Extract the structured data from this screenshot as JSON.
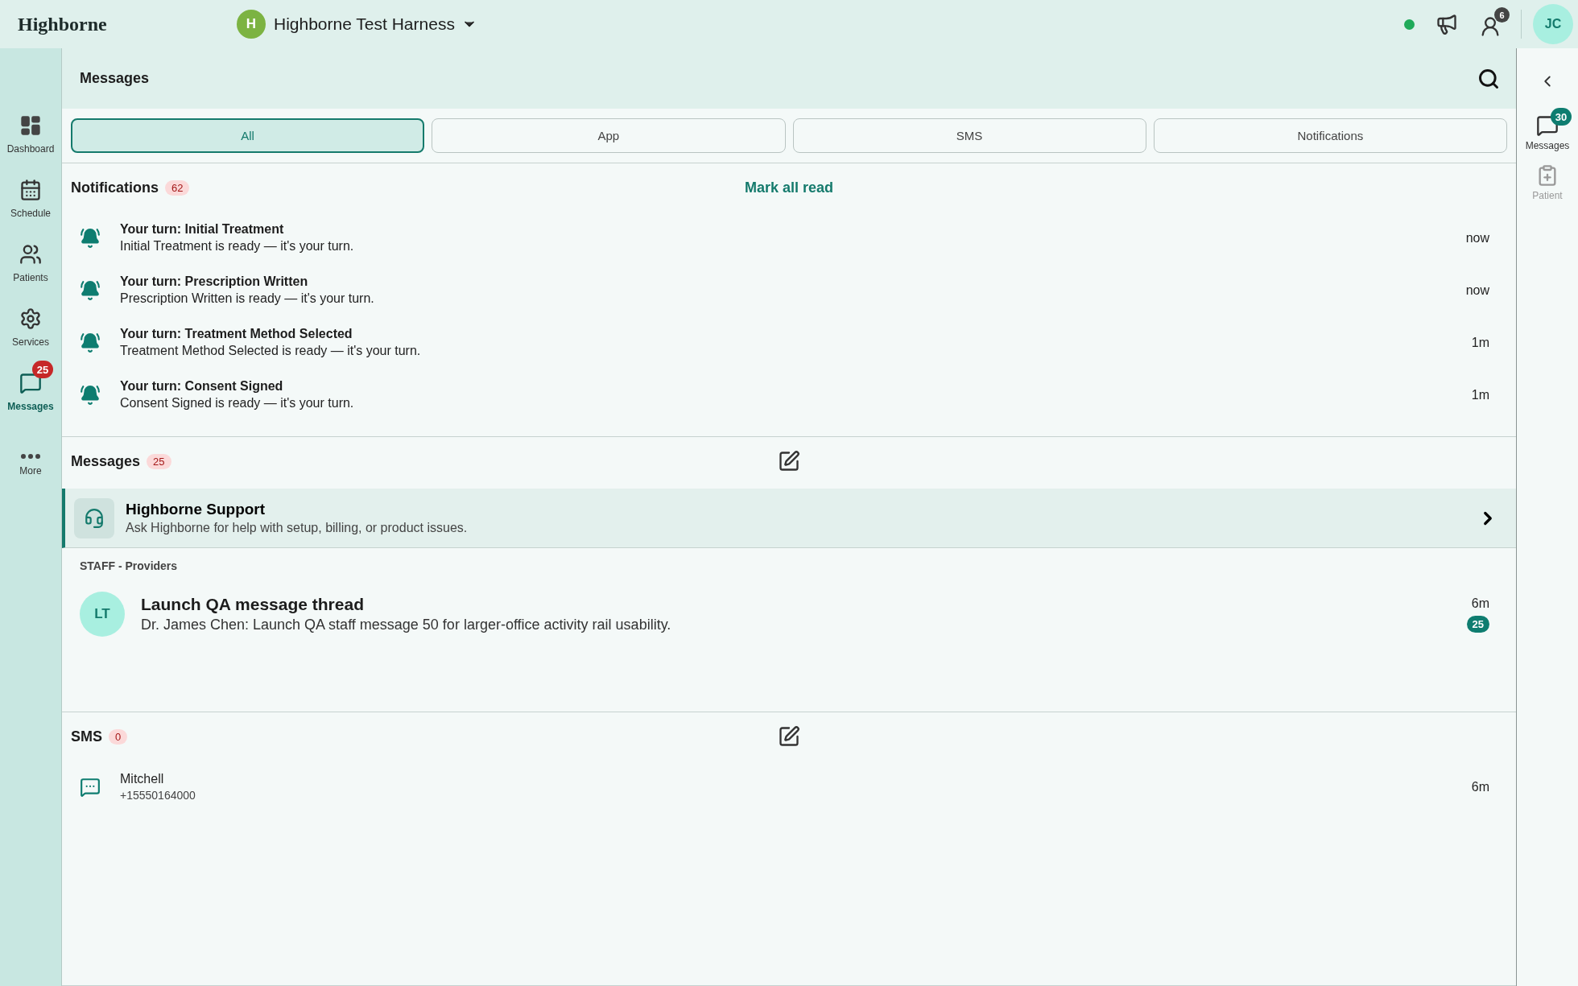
{
  "topbar": {
    "logo": "Highborne",
    "org_initial": "H",
    "org_name": "Highborne Test Harness",
    "status_online": true,
    "staff_count": "6",
    "user_initials": "JC"
  },
  "sidebar": {
    "items": [
      {
        "label": "Dashboard",
        "selected": false
      },
      {
        "label": "Schedule",
        "selected": false
      },
      {
        "label": "Patients",
        "selected": false
      },
      {
        "label": "Services",
        "selected": false
      },
      {
        "label": "Messages",
        "selected": true,
        "badge": "25"
      },
      {
        "label": "More",
        "selected": false
      }
    ]
  },
  "page": {
    "title": "Messages"
  },
  "tabs": [
    {
      "label": "All",
      "selected": true
    },
    {
      "label": "App",
      "selected": false
    },
    {
      "label": "SMS",
      "selected": false
    },
    {
      "label": "Notifications",
      "selected": false
    }
  ],
  "notifications": {
    "title": "Notifications",
    "count": "62",
    "action": "Mark all read",
    "items": [
      {
        "title": "Your turn: Initial Treatment",
        "body": "Initial Treatment is ready — it's your turn.",
        "time": "now"
      },
      {
        "title": "Your turn: Prescription Written",
        "body": "Prescription Written is ready — it's your turn.",
        "time": "now"
      },
      {
        "title": "Your turn: Treatment Method Selected",
        "body": "Treatment Method Selected is ready — it's your turn.",
        "time": "1m"
      },
      {
        "title": "Your turn: Consent Signed",
        "body": "Consent Signed is ready — it's your turn.",
        "time": "1m"
      }
    ]
  },
  "messages": {
    "title": "Messages",
    "count": "25",
    "support": {
      "title": "Highborne Support",
      "body": "Ask Highborne for help with setup, billing, or product issues."
    },
    "group": "STAFF - Providers",
    "threads": [
      {
        "initials": "LT",
        "title": "Launch QA message thread",
        "body": "Dr. James Chen: Launch QA staff message 50 for larger-office activity rail usability.",
        "time": "6m",
        "unread": "25"
      }
    ]
  },
  "sms": {
    "title": "SMS",
    "count": "0",
    "items": [
      {
        "name": "Mitchell",
        "phone": "+15550164000",
        "time": "6m"
      }
    ]
  },
  "rail": {
    "items": [
      {
        "label": "Messages",
        "badge": "30",
        "disabled": false
      },
      {
        "label": "Patient",
        "disabled": true
      }
    ]
  }
}
